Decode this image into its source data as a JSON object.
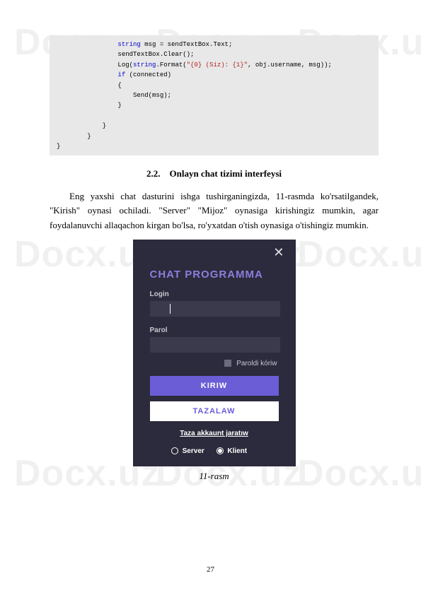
{
  "watermark": "Docx.uz",
  "code_lines": [
    {
      "indent": 16,
      "segments": [
        {
          "t": "string",
          "cls": "kw"
        },
        {
          "t": " msg = sendTextBox.Text;"
        }
      ]
    },
    {
      "indent": 16,
      "segments": [
        {
          "t": "sendTextBox.Clear();"
        }
      ]
    },
    {
      "indent": 16,
      "segments": [
        {
          "t": "Log("
        },
        {
          "t": "string",
          "cls": "kw"
        },
        {
          "t": ".Format("
        },
        {
          "t": "\"{0} (Siz): {1}\"",
          "cls": "str"
        },
        {
          "t": ", obj.username, msg));"
        }
      ]
    },
    {
      "indent": 16,
      "segments": [
        {
          "t": "if",
          "cls": "kw"
        },
        {
          "t": " (connected)"
        }
      ]
    },
    {
      "indent": 16,
      "segments": [
        {
          "t": "{"
        }
      ]
    },
    {
      "indent": 20,
      "segments": [
        {
          "t": "Send(msg);"
        }
      ]
    },
    {
      "indent": 16,
      "segments": [
        {
          "t": "}"
        }
      ]
    },
    {
      "indent": 0,
      "segments": [
        {
          "t": ""
        }
      ]
    },
    {
      "indent": 12,
      "segments": [
        {
          "t": "}"
        }
      ]
    },
    {
      "indent": 8,
      "segments": [
        {
          "t": "}"
        }
      ]
    },
    {
      "indent": 0,
      "segments": [
        {
          "t": "}"
        }
      ]
    }
  ],
  "heading_number": "2.2.",
  "heading_text": "Onlayn chat tizimi interfeysi",
  "paragraph": "Eng yaxshi chat dasturini ishga tushirganingizda, 11-rasmda ko'rsatilgandek, \"Kirish\" oynasi ochiladi. \"Server\" \"Mijoz\" oynasiga kirishingiz mumkin, agar foydalanuvchi allaqachon kirgan bo'lsa, ro'yxatdan o'tish oynasiga o'tishingiz mumkin.",
  "figure": {
    "title": "CHAT PROGRAMMA",
    "login_label": "Login",
    "login_value": "",
    "parol_label": "Parol",
    "parol_value": "",
    "show_password_label": "Paroldi kóriw",
    "btn_login": "KIRIW",
    "btn_clear": "TAZALAW",
    "link_create": "Taza akkaunt jaratıw",
    "radio_server": "Server",
    "radio_klient": "Klient"
  },
  "caption": "11-rasm",
  "page_number": "27"
}
